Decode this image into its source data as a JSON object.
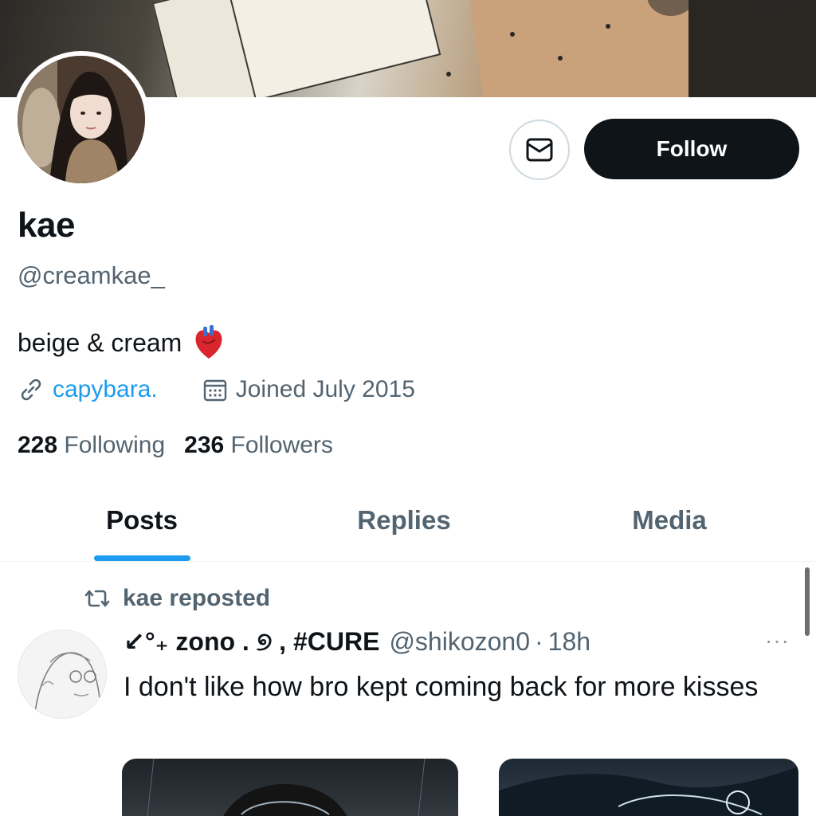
{
  "profile": {
    "display_name": "kae",
    "handle": "@creamkae_",
    "bio": "beige & cream",
    "bio_emoji": "anatomical-heart",
    "website": "capybara.",
    "joined": "Joined July 2015"
  },
  "actions": {
    "follow_label": "Follow"
  },
  "stats": {
    "following_count": "228",
    "following_label": "Following",
    "followers_count": "236",
    "followers_label": "Followers"
  },
  "tabs": [
    {
      "label": "Posts",
      "active": true
    },
    {
      "label": "Replies",
      "active": false
    },
    {
      "label": "Media",
      "active": false
    }
  ],
  "post": {
    "repost_label": "kae reposted",
    "author_name": "↙°₊ zono . ୭ , #CURE",
    "author_handle": "@shikozon0",
    "separator": "·",
    "time": "18h",
    "more": "···",
    "text": "I don't like how bro kept coming back for more kisses"
  },
  "colors": {
    "accent": "#1d9bf0",
    "text_primary": "#0f1419",
    "text_secondary": "#536471",
    "follow_bg": "#0f1419"
  }
}
